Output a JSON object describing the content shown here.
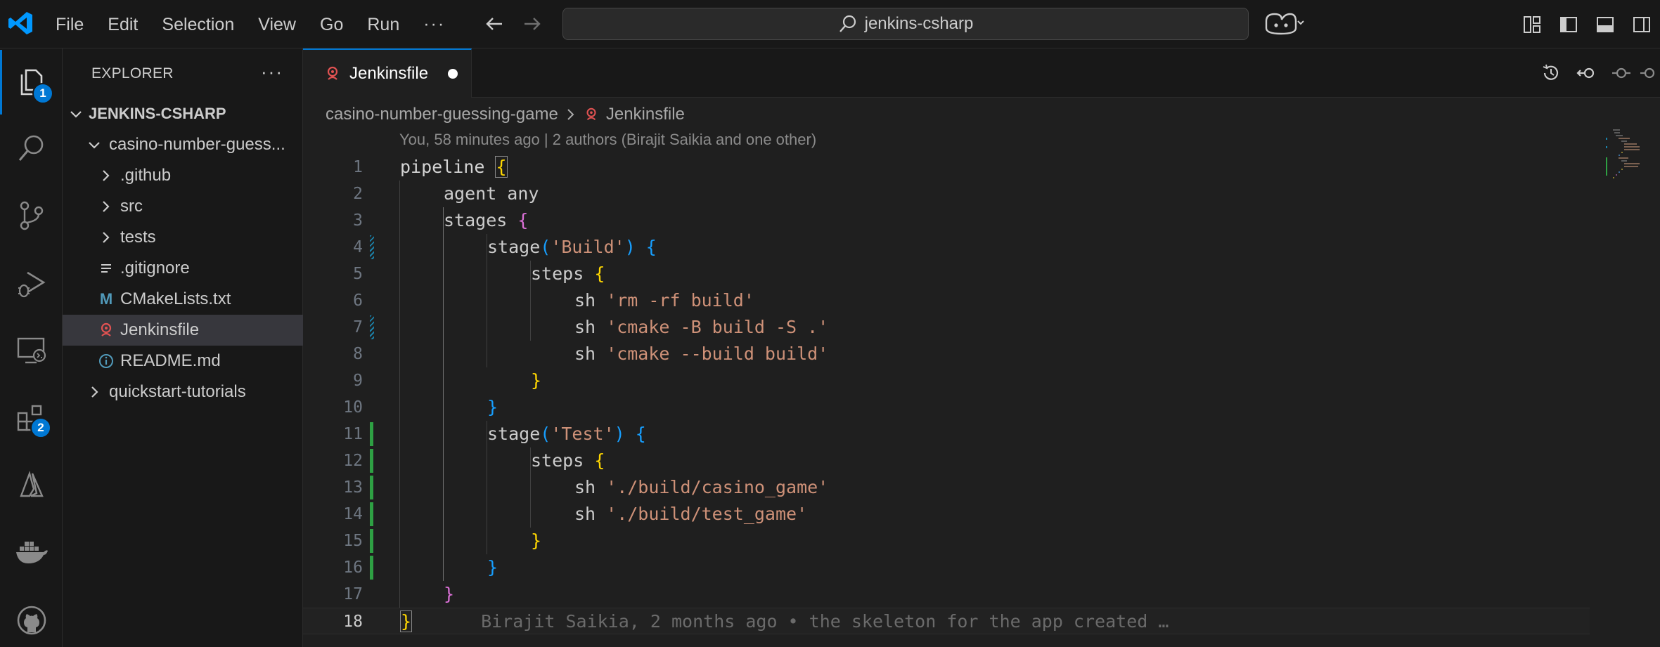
{
  "menu": [
    "File",
    "Edit",
    "Selection",
    "View",
    "Go",
    "Run"
  ],
  "menu_more": "···",
  "command_center": {
    "text": "jenkins-csharp"
  },
  "activity_badges": {
    "explorer": "1",
    "extensions": "2"
  },
  "sidebar": {
    "title": "EXPLORER",
    "more": "···",
    "tree": [
      {
        "label": "JENKINS-CSHARP",
        "chevron": "down",
        "indent": 0,
        "bold": true
      },
      {
        "label": "casino-number-guess...",
        "chevron": "down",
        "indent": 1
      },
      {
        "label": ".github",
        "chevron": "right",
        "indent": 2
      },
      {
        "label": "src",
        "chevron": "right",
        "indent": 2
      },
      {
        "label": "tests",
        "chevron": "right",
        "indent": 2
      },
      {
        "label": ".gitignore",
        "icon": "lines-icon",
        "indent": 2
      },
      {
        "label": "CMakeLists.txt",
        "icon": "cmake-icon",
        "glyph": "M",
        "indent": 2
      },
      {
        "label": "Jenkinsfile",
        "icon": "jenkins-icon",
        "indent": 2,
        "selected": true
      },
      {
        "label": "README.md",
        "icon": "info-icon",
        "indent": 2
      },
      {
        "label": "quickstart-tutorials",
        "chevron": "right",
        "indent": 1
      }
    ]
  },
  "tab": {
    "label": "Jenkinsfile",
    "dirty": true
  },
  "breadcrumb": {
    "folder": "casino-number-guessing-game",
    "sep": ">",
    "file": "Jenkinsfile"
  },
  "blame_header": "You, 58 minutes ago | 2 authors (Birajit Saikia and one other)",
  "code_lines": [
    {
      "n": "1"
    },
    {
      "n": "2"
    },
    {
      "n": "3"
    },
    {
      "n": "4"
    },
    {
      "n": "5"
    },
    {
      "n": "6"
    },
    {
      "n": "7"
    },
    {
      "n": "8"
    },
    {
      "n": "9"
    },
    {
      "n": "10"
    },
    {
      "n": "11"
    },
    {
      "n": "12"
    },
    {
      "n": "13"
    },
    {
      "n": "14"
    },
    {
      "n": "15"
    },
    {
      "n": "16"
    },
    {
      "n": "17"
    },
    {
      "n": "18"
    }
  ],
  "code": {
    "l1_kw": "pipeline ",
    "l1_b": "{",
    "l2": "agent any",
    "l3_kw": "stages ",
    "l3_b": "{",
    "l4_kw": "stage",
    "l4_p1": "(",
    "l4_s": "'Build'",
    "l4_p2": ")",
    "l4_b": " {",
    "l5_kw": "steps ",
    "l5_b": "{",
    "l6_kw": "sh ",
    "l6_s": "'rm -rf build'",
    "l7_kw": "sh ",
    "l7_s": "'cmake -B build -S .'",
    "l8_kw": "sh ",
    "l8_s": "'cmake --build build'",
    "l9_b": "}",
    "l10_b": "}",
    "l11_kw": "stage",
    "l11_p1": "(",
    "l11_s": "'Test'",
    "l11_p2": ")",
    "l11_b": " {",
    "l12_kw": "steps ",
    "l12_b": "{",
    "l13_kw": "sh ",
    "l13_s": "'./build/casino_game'",
    "l14_kw": "sh ",
    "l14_s": "'./build/test_game'",
    "l15_b": "}",
    "l16_b": "}",
    "l17_b": "}",
    "l18_b": "}",
    "l18_blame": "Birajit Saikia, 2 months ago • the skeleton for the app created …"
  },
  "colors": {
    "accent": "#0078d4",
    "git_added": "#2ea043",
    "git_modified": "#1b81a8",
    "string": "#ce9178",
    "bracket_1": "#ffd700",
    "bracket_2": "#da70d6",
    "bracket_3": "#179fff"
  }
}
